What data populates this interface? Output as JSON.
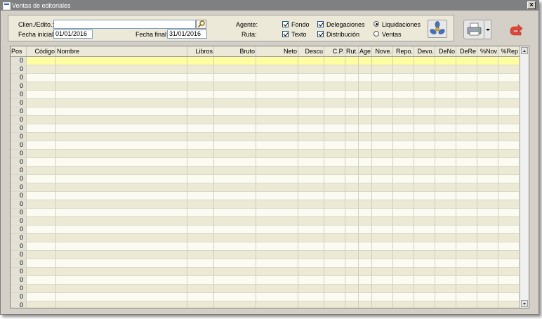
{
  "window": {
    "title": "Ventas de editoriales",
    "close_label": "×"
  },
  "filters": {
    "cliente_label": "Clien./Edito.:",
    "cliente_value": "",
    "fecha_inicial_label": "Fecha inicial:",
    "fecha_inicial_value": "01/01/2016",
    "fecha_final_label": "Fecha final:",
    "fecha_final_value": "31/01/2016",
    "agente_label": "Agente:",
    "ruta_label": "Ruta:"
  },
  "checkboxes": {
    "fondo": {
      "label": "Fondo",
      "checked": true
    },
    "texto": {
      "label": "Texto",
      "checked": true
    },
    "delegaciones": {
      "label": "Delegaciones",
      "checked": true
    },
    "distribucion": {
      "label": "Distribución",
      "checked": true
    }
  },
  "radios": {
    "liquidaciones": {
      "label": "Liquidaciones",
      "selected": true
    },
    "ventas": {
      "label": "Ventas",
      "selected": false
    }
  },
  "icons": {
    "search": "magnifier-icon",
    "fan": "fan-icon",
    "print": "printer-icon",
    "exit": "exit-arrow-icon"
  },
  "columns": [
    "Pos",
    "Código",
    "Nombre",
    "Libros",
    "Bruto",
    "Neto",
    "Descu",
    "C.P.",
    "Rut.",
    "Age.",
    "Nove.",
    "Repo.",
    "Devo.",
    "DeNo",
    "DeRe",
    "%Nov",
    "%Rep"
  ],
  "rows": [
    "0",
    "0",
    "0",
    "0",
    "0",
    "0",
    "0",
    "0",
    "0",
    "0",
    "0",
    "0",
    "0",
    "0",
    "0",
    "0",
    "0",
    "0",
    "0",
    "0",
    "0",
    "0",
    "0",
    "0",
    "0",
    "0",
    "0",
    "0",
    "0",
    "0",
    "0"
  ],
  "colors": {
    "selected_row": "#fefea0",
    "alt_row": "#ecead5",
    "exit_red": "#e0473a"
  }
}
